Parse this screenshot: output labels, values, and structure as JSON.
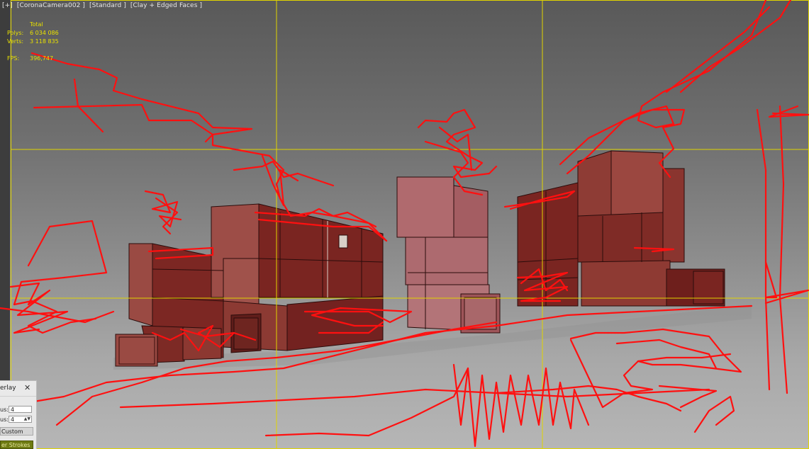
{
  "viewport": {
    "label_parts": [
      "[+]",
      "[CoronaCamera002 ]",
      "[Standard ]",
      "[Clay + Edged Faces ]"
    ]
  },
  "stats": {
    "total_label": "Total",
    "polys_label": "Polys:",
    "polys_value": "6 034 086",
    "verts_label": "Verts:",
    "verts_value": "3 118 835",
    "fps_label": "FPS:",
    "fps_value": "396,747"
  },
  "overlay_panel": {
    "title": "erlay",
    "close_icon": "close-icon",
    "field1_label": "us:",
    "field1_value": "4",
    "field2_label": "us:",
    "field2_value": "4",
    "custom_button_label": "Custom",
    "apply_button_label": "er Strokes"
  },
  "colors": {
    "safe_frame": "#e0d400",
    "stroke": "#ff1010",
    "building_dark": "#7a2521",
    "building_mid": "#94403a",
    "building_light": "#b06a6e",
    "stats_text": "#e8e000"
  }
}
